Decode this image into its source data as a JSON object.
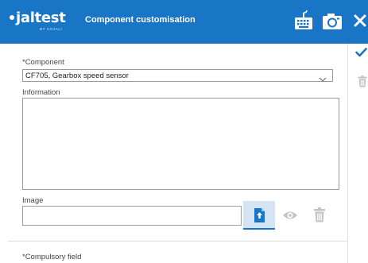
{
  "header": {
    "logo_main": "jaltest",
    "logo_sub": "BY COJALI",
    "title": "Component customisation",
    "icons": [
      "keyboard-icon",
      "camera-icon",
      "close-icon"
    ],
    "background": "#1976c6"
  },
  "form": {
    "component_label": "*Component",
    "component_value": "CF705, Gearbox speed sensor",
    "information_label": "Information",
    "information_value": "",
    "image_label": "Image",
    "image_value": "",
    "compulsory_note": "*Compulsory field"
  },
  "image_actions": [
    "upload-icon",
    "eye-icon",
    "trash-icon"
  ],
  "sidebar": {
    "actions": [
      "checkmark-icon",
      "trash-icon"
    ]
  },
  "colors": {
    "accent": "#1976c6",
    "upload_button_bg": "#d4e4f2",
    "disabled_icon": "#c4c4c4"
  }
}
